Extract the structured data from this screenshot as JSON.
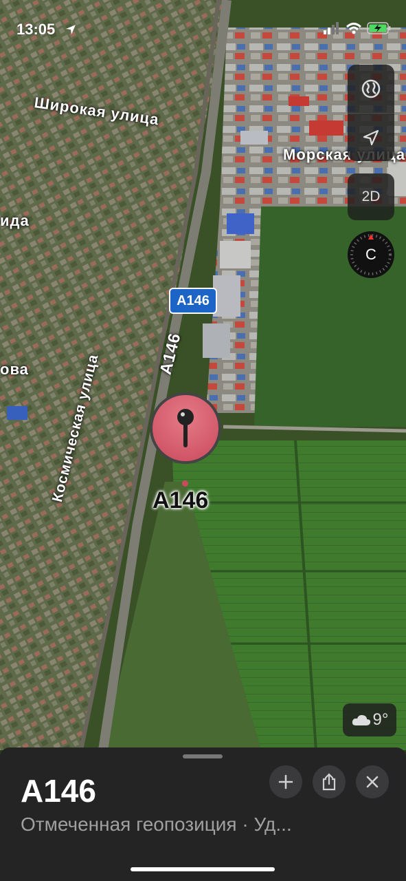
{
  "status_bar": {
    "time": "13:05"
  },
  "map": {
    "street_labels": [
      "Широкая улица",
      "Морская улица",
      "Космическая улица",
      "ида",
      "ова"
    ],
    "road_shield": "A146",
    "road_label": "A146",
    "pin_label": "A146",
    "colors": {
      "field": "#3d6b2a",
      "urban": "#6b6a55",
      "road": "#8c8c82"
    }
  },
  "controls": {
    "globe_icon": "globe-icon",
    "location_icon": "location-arrow-icon",
    "view_mode_label": "2D",
    "compass_label": "С"
  },
  "weather": {
    "temperature": "9°",
    "icon": "cloud-icon"
  },
  "sheet": {
    "title": "A146",
    "subtitle": "Отмеченная геопозиция · Уд...",
    "actions": [
      "add-icon",
      "share-icon",
      "close-icon"
    ]
  }
}
